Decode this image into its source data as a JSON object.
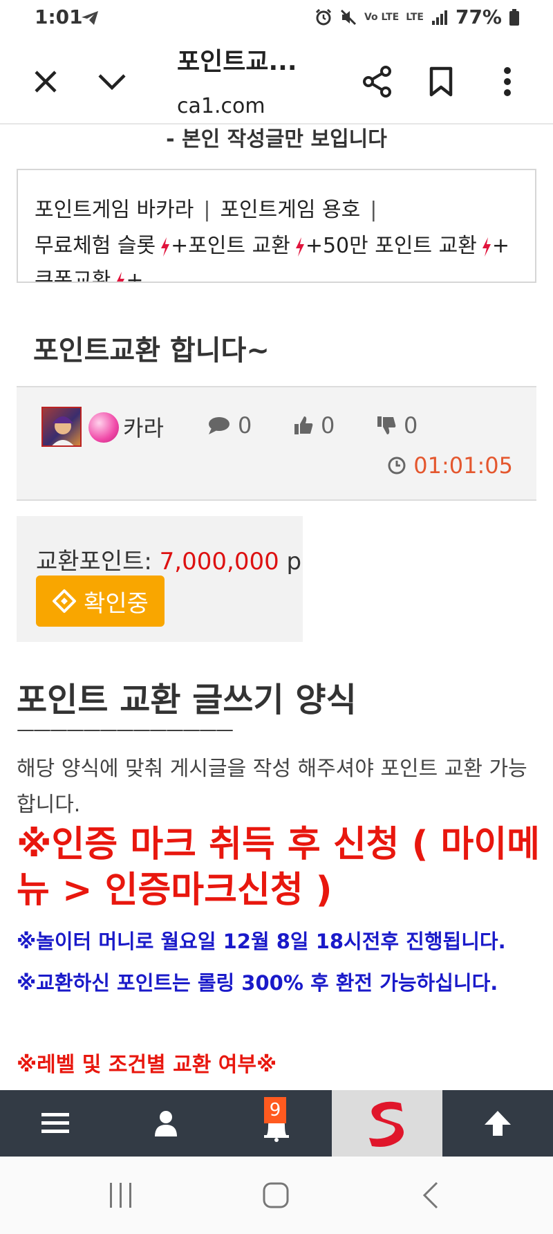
{
  "status_bar": {
    "time": "1:01",
    "network_label": "Vo LTE",
    "lte_label": "LTE",
    "battery": "77%"
  },
  "browser": {
    "title": "포인트교...",
    "url": "ca1.com"
  },
  "notice": "- 본인 작성글만 보입니다",
  "categories": {
    "line1": [
      "포인트게임 바카라",
      "포인트게임 용호"
    ],
    "line2": [
      "무료체험 슬롯",
      "+포인트 교환",
      "+50만 포인트 교환",
      "+"
    ],
    "line3": [
      "쿠폰교환",
      "+"
    ]
  },
  "post": {
    "title": "포인트교환 합니다~",
    "author": "카라",
    "comments": "0",
    "likes": "0",
    "dislikes": "0",
    "time": "01:01:05"
  },
  "exchange": {
    "label": "교환포인트: ",
    "value": "7,000,000",
    "unit": " p",
    "status_button": "확인중"
  },
  "content": {
    "heading": "포인트 교환 글쓰기 양식",
    "dashes": "—————————————",
    "paragraph": "해당 양식에 맞춰 게시글을 작성 해주셔야 포인트 교환 가능합니다.",
    "big_notice": "※인증 마크 취득 후 신청 ( 마이메뉴 > 인증마크신청 )",
    "blue_notice_1": "※놀이터 머니로 월요일 12월 8일 18시전후 진행됩니다.",
    "blue_notice_2": "※교환하신 포인트는 롤링 300% 후 환전 가능하십니다.",
    "red_notice": "※레벨 및 조건별 교환 여부※"
  },
  "bottom_nav": {
    "notification_count": "9"
  },
  "colors": {
    "accent_orange": "#f9a600",
    "red": "#e8170e",
    "blue": "#1a1ac9",
    "nav_bg": "#333b45",
    "time_orange": "#e4572e"
  }
}
